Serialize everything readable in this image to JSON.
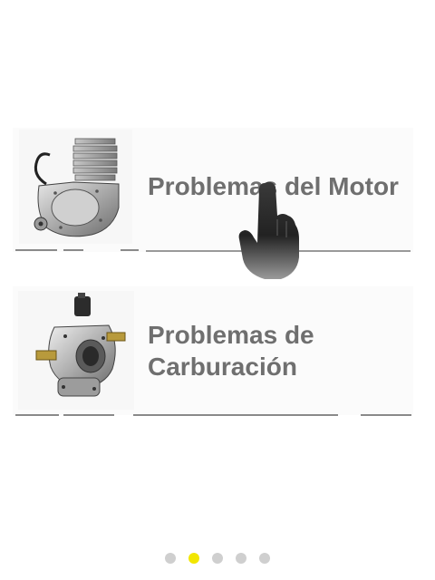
{
  "cards": [
    {
      "title": "Problemas del Motor",
      "image_icon": "engine-icon"
    },
    {
      "title_line1": "Problemas de",
      "title_line2": "Carburación",
      "image_icon": "carburetor-icon"
    }
  ],
  "overlay": {
    "icon": "hand-pointer-icon"
  },
  "pager": {
    "count": 5,
    "active_index": 1,
    "active_color": "#f2e600",
    "inactive_color": "#cfcfcf"
  }
}
